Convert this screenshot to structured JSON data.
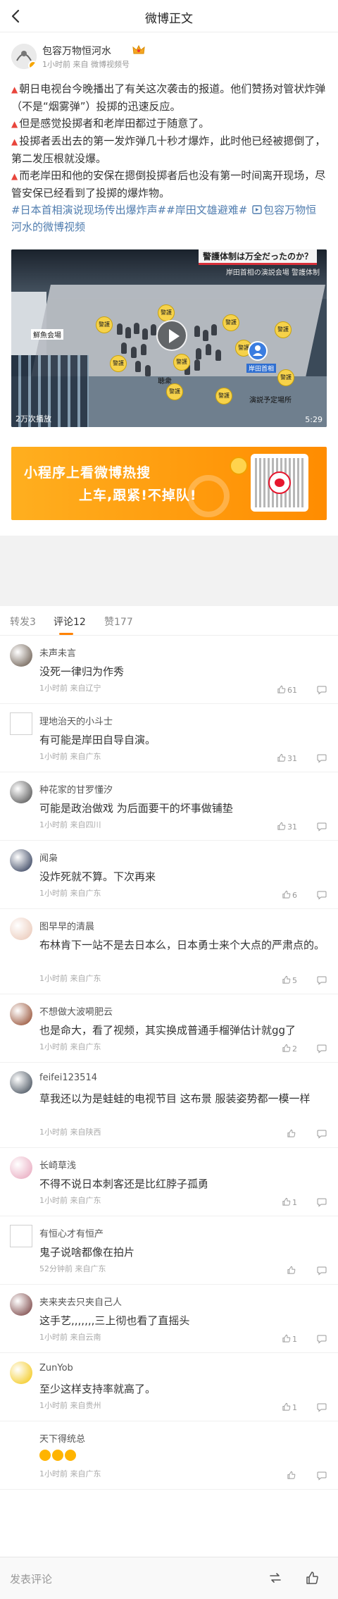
{
  "header": {
    "title": "微博正文"
  },
  "author": {
    "name": "包容万物恒河水",
    "time": "1小时前",
    "source": "来自 微博视频号"
  },
  "post": {
    "paragraphs": [
      "朝日电视台今晚播出了有关这次袭击的报道。他们赞扬对管状炸弹（不是“烟雾弹”）投掷的迅速反应。",
      "但是感觉投掷者和老岸田都过于随意了。",
      "投掷者丢出去的第一发炸弹几十秒才爆炸，此时他已经被摁倒了，第二发压根就没爆。",
      "而老岸田和他的安保在摁倒投掷者后也没有第一时间离开现场，尽管安保已经看到了投掷的爆炸物。"
    ],
    "hashtags": "#日本首相演说现场传出爆炸声##岸田文雄避难#",
    "video_link": "包容万物恒河水的微博视频"
  },
  "video": {
    "caption": "警護体制は万全だったのか？",
    "subcaption": "岸田首相の演説会場 警護体制",
    "label_food": "鮮魚会場",
    "label_podium": "聴衆",
    "label_speech": "演説予定場所",
    "label_pm": "岸田首相",
    "guard_label": "警護",
    "play_count": "2万次播放",
    "duration": "5:29"
  },
  "banner": {
    "line1": "小程序上看微博热搜",
    "line2": "上车,跟紧!不掉队!"
  },
  "tabs": [
    {
      "label": "转发3"
    },
    {
      "label": "评论12"
    },
    {
      "label": "赞177"
    }
  ],
  "comments": [
    {
      "name": "未声未言",
      "text": "没死一律归为作秀",
      "time": "1小时前",
      "source": "来自辽宁",
      "likes": "61",
      "avatar_color": "#5a4a3c"
    },
    {
      "name": "理地治天的小斗士",
      "text": "有可能是岸田自导自演。",
      "time": "1小时前",
      "source": "来自广东",
      "likes": "31",
      "avatar_color": "#ffffff"
    },
    {
      "name": "种花家的甘罗懂汐",
      "text": "可能是政治做戏 为后面要干的坏事做铺垫",
      "time": "1小时前",
      "source": "来自四川",
      "likes": "31",
      "avatar_color": "#3f3f3f"
    },
    {
      "name": "闻枭",
      "text": "没炸死就不算。下次再来",
      "time": "1小时前",
      "source": "来自广东",
      "likes": "6",
      "avatar_color": "#1d2a4a"
    },
    {
      "name": "图早早的清晨",
      "text": "布林肯下一站不是去日本么，日本勇士来个大点的严肃点的。",
      "time": "1小时前",
      "source": "来自广东",
      "likes": "5",
      "avatar_color": "#e8c3b1"
    },
    {
      "name": "不想做大波嗬肥云",
      "text": "也是命大，看了视频，其实换成普通手榴弹估计就gg了",
      "time": "1小时前",
      "source": "来自广东",
      "likes": "2",
      "avatar_color": "#8a3b1c"
    },
    {
      "name": "feifei123514",
      "text": "草我还以为是蛙蛙的电视节目 这布景 服装姿势都一模一样",
      "time": "1小时前",
      "source": "来自陕西",
      "likes": "",
      "avatar_color": "#2e3a48"
    },
    {
      "name": "长崎草浅",
      "text": "不得不说日本刺客还是比红脖子孤勇",
      "time": "1小时前",
      "source": "来自广东",
      "likes": "1",
      "avatar_color": "#e6a0b8"
    },
    {
      "name": "有恒心才有恒产",
      "text": "鬼子说啥都像在拍片",
      "time": "52分钟前",
      "source": "来自广东",
      "likes": "",
      "avatar_color": "#ffffff"
    },
    {
      "name": "夹来夹去只夹自己人",
      "text": "这手艺,,,,,,,三上彻也看了直摇头",
      "time": "1小时前",
      "source": "来自云南",
      "likes": "1",
      "avatar_color": "#6b2f2f"
    },
    {
      "name": "ZunYob",
      "text": "至少这样支持率就高了。",
      "time": "1小时前",
      "source": "来自贵州",
      "likes": "1",
      "avatar_color": "#f2c200"
    },
    {
      "name": "天下得统总",
      "text": "",
      "time": "1小时前",
      "source": "来自广东",
      "likes": "",
      "avatar_color": "#ffffff"
    }
  ],
  "bottom": {
    "placeholder": "发表评论"
  },
  "colors": {
    "accent": "#ff8200",
    "link": "#507daf",
    "warning": "#e8463c"
  }
}
